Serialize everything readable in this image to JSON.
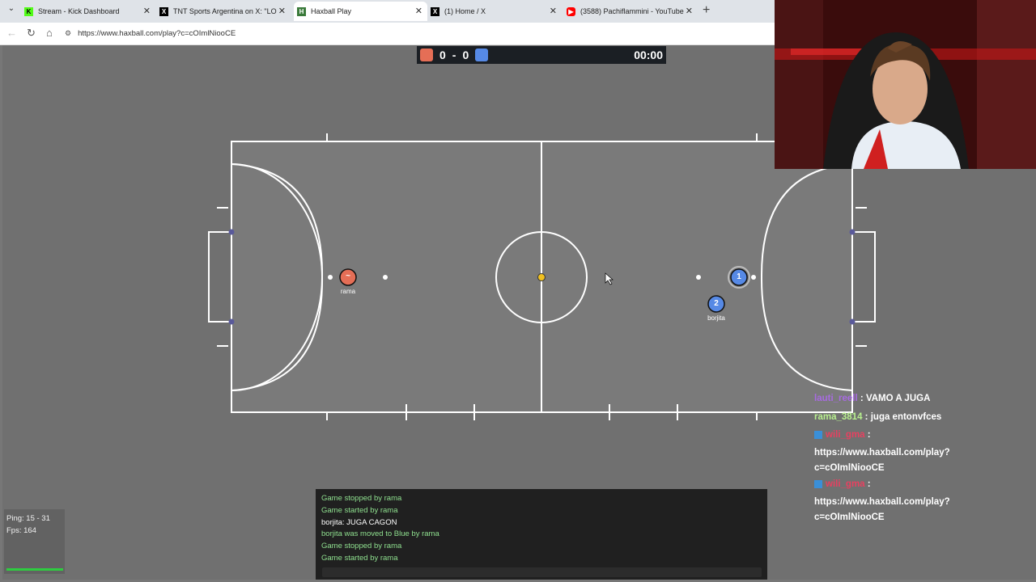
{
  "tabs": [
    {
      "label": "Stream - Kick Dashboard",
      "icon": "kick-icon",
      "color": "#53fc18"
    },
    {
      "label": "TNT Sports Argentina on X: \"LO AT",
      "icon": "x-icon",
      "color": "#000000"
    },
    {
      "label": "Haxball Play",
      "icon": "haxball-icon",
      "color": "#3a7a3a",
      "active": true
    },
    {
      "label": "(1) Home / X",
      "icon": "x-icon",
      "color": "#000000"
    },
    {
      "label": "(3588) Pachiflammini - YouTube",
      "icon": "youtube-icon",
      "color": "#ff0000"
    }
  ],
  "url": "https://www.haxball.com/play?c=cOImlNiooCE",
  "scoreboard": {
    "red_score": "0",
    "dash": "-",
    "blue_score": "0",
    "time": "00:00",
    "red_color": "#e56e56",
    "blue_color": "#5689e5"
  },
  "players": [
    {
      "team": "red",
      "avatar": "~",
      "name": "rama"
    },
    {
      "team": "blue",
      "avatar": "1",
      "name": ""
    },
    {
      "team": "blue",
      "avatar": "2",
      "name": "borjita"
    }
  ],
  "stats": {
    "ping": "Ping: 15 - 31",
    "fps": "Fps: 164"
  },
  "game_chat": [
    {
      "text": "Game stopped by rama",
      "white": false
    },
    {
      "text": "Game started by rama",
      "white": false
    },
    {
      "text": "borjita: JUGA CAGON",
      "white": true
    },
    {
      "text": "borjita was moved to Blue by rama",
      "white": false
    },
    {
      "text": "Game stopped by rama",
      "white": false
    },
    {
      "text": "Game started by rama",
      "white": false
    }
  ],
  "stream_chat": [
    {
      "user": "lauti_reell",
      "sep": " : ",
      "msg": "VAMO A JUGA"
    },
    {
      "user": "rama_3814",
      "sep": " : ",
      "msg": "juga entonvfces"
    },
    {
      "user": "wili_gma",
      "sep": " :",
      "msg": "https://www.haxball.com/play?c=cOImlNiooCE"
    },
    {
      "user": "wili_gma",
      "sep": " :",
      "msg": "https://www.haxball.com/play?c=cOImlNiooCE"
    }
  ]
}
